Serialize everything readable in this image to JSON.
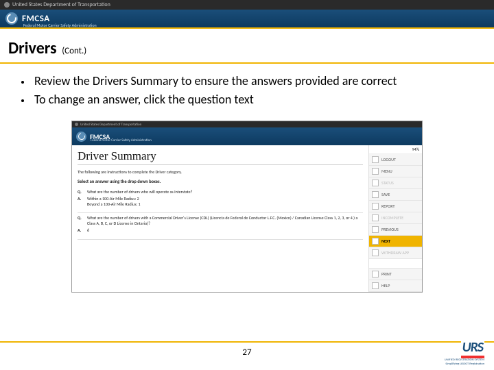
{
  "topbar": {
    "org": "United States Department of Transportation"
  },
  "brand": {
    "name": "FMCSA",
    "sub": "Federal Motor Carrier Safety Administration"
  },
  "slide": {
    "title": "Drivers",
    "cont": "(Cont.)",
    "bullets": [
      "Review the Drivers Summary to ensure the answers provided are correct",
      "To change an answer, click the question text"
    ],
    "page": "27"
  },
  "screenshot": {
    "topbar": "United States Department of Transportation",
    "brand": "FMCSA",
    "brand_sub": "Federal Motor Carrier Safety Administration",
    "heading": "Driver Summary",
    "instr1": "The following are instructions to complete the Driver category.",
    "instr2": "Select an answer using the drop down boxes.",
    "qa": [
      {
        "q": "What are the number of drivers who will operate as Interstate?",
        "a": "Within a 100-Air Mile Radius:   2\nBeyond a 100-Air Mile Radius:   1"
      },
      {
        "q": "What are the number of drivers with a Commercial Driver's License (CDL) (Licencia de Federal de Conductor L.F.C. (Mexico) / Canadian License Class 1, 2, 3, or 4 ) a Class A, B, C, or D License in Ontario)?",
        "a": "6"
      }
    ],
    "percent": "94%",
    "side": {
      "logout": "LOGOUT",
      "menu": "MENU",
      "status": "STATUS",
      "save": "SAVE",
      "report": "REPORT",
      "incomplete": "INCOMPLETE",
      "previous": "PREVIOUS",
      "next": "NEXT",
      "withdraw": "WITHDRAW APP",
      "print": "PRINT",
      "help": "HELP"
    }
  },
  "footer_logo": {
    "main": "URS",
    "sub1": "UNIFIED REGISTRATION SYSTEM",
    "sub2": "Simplifying USDOT Registration"
  }
}
